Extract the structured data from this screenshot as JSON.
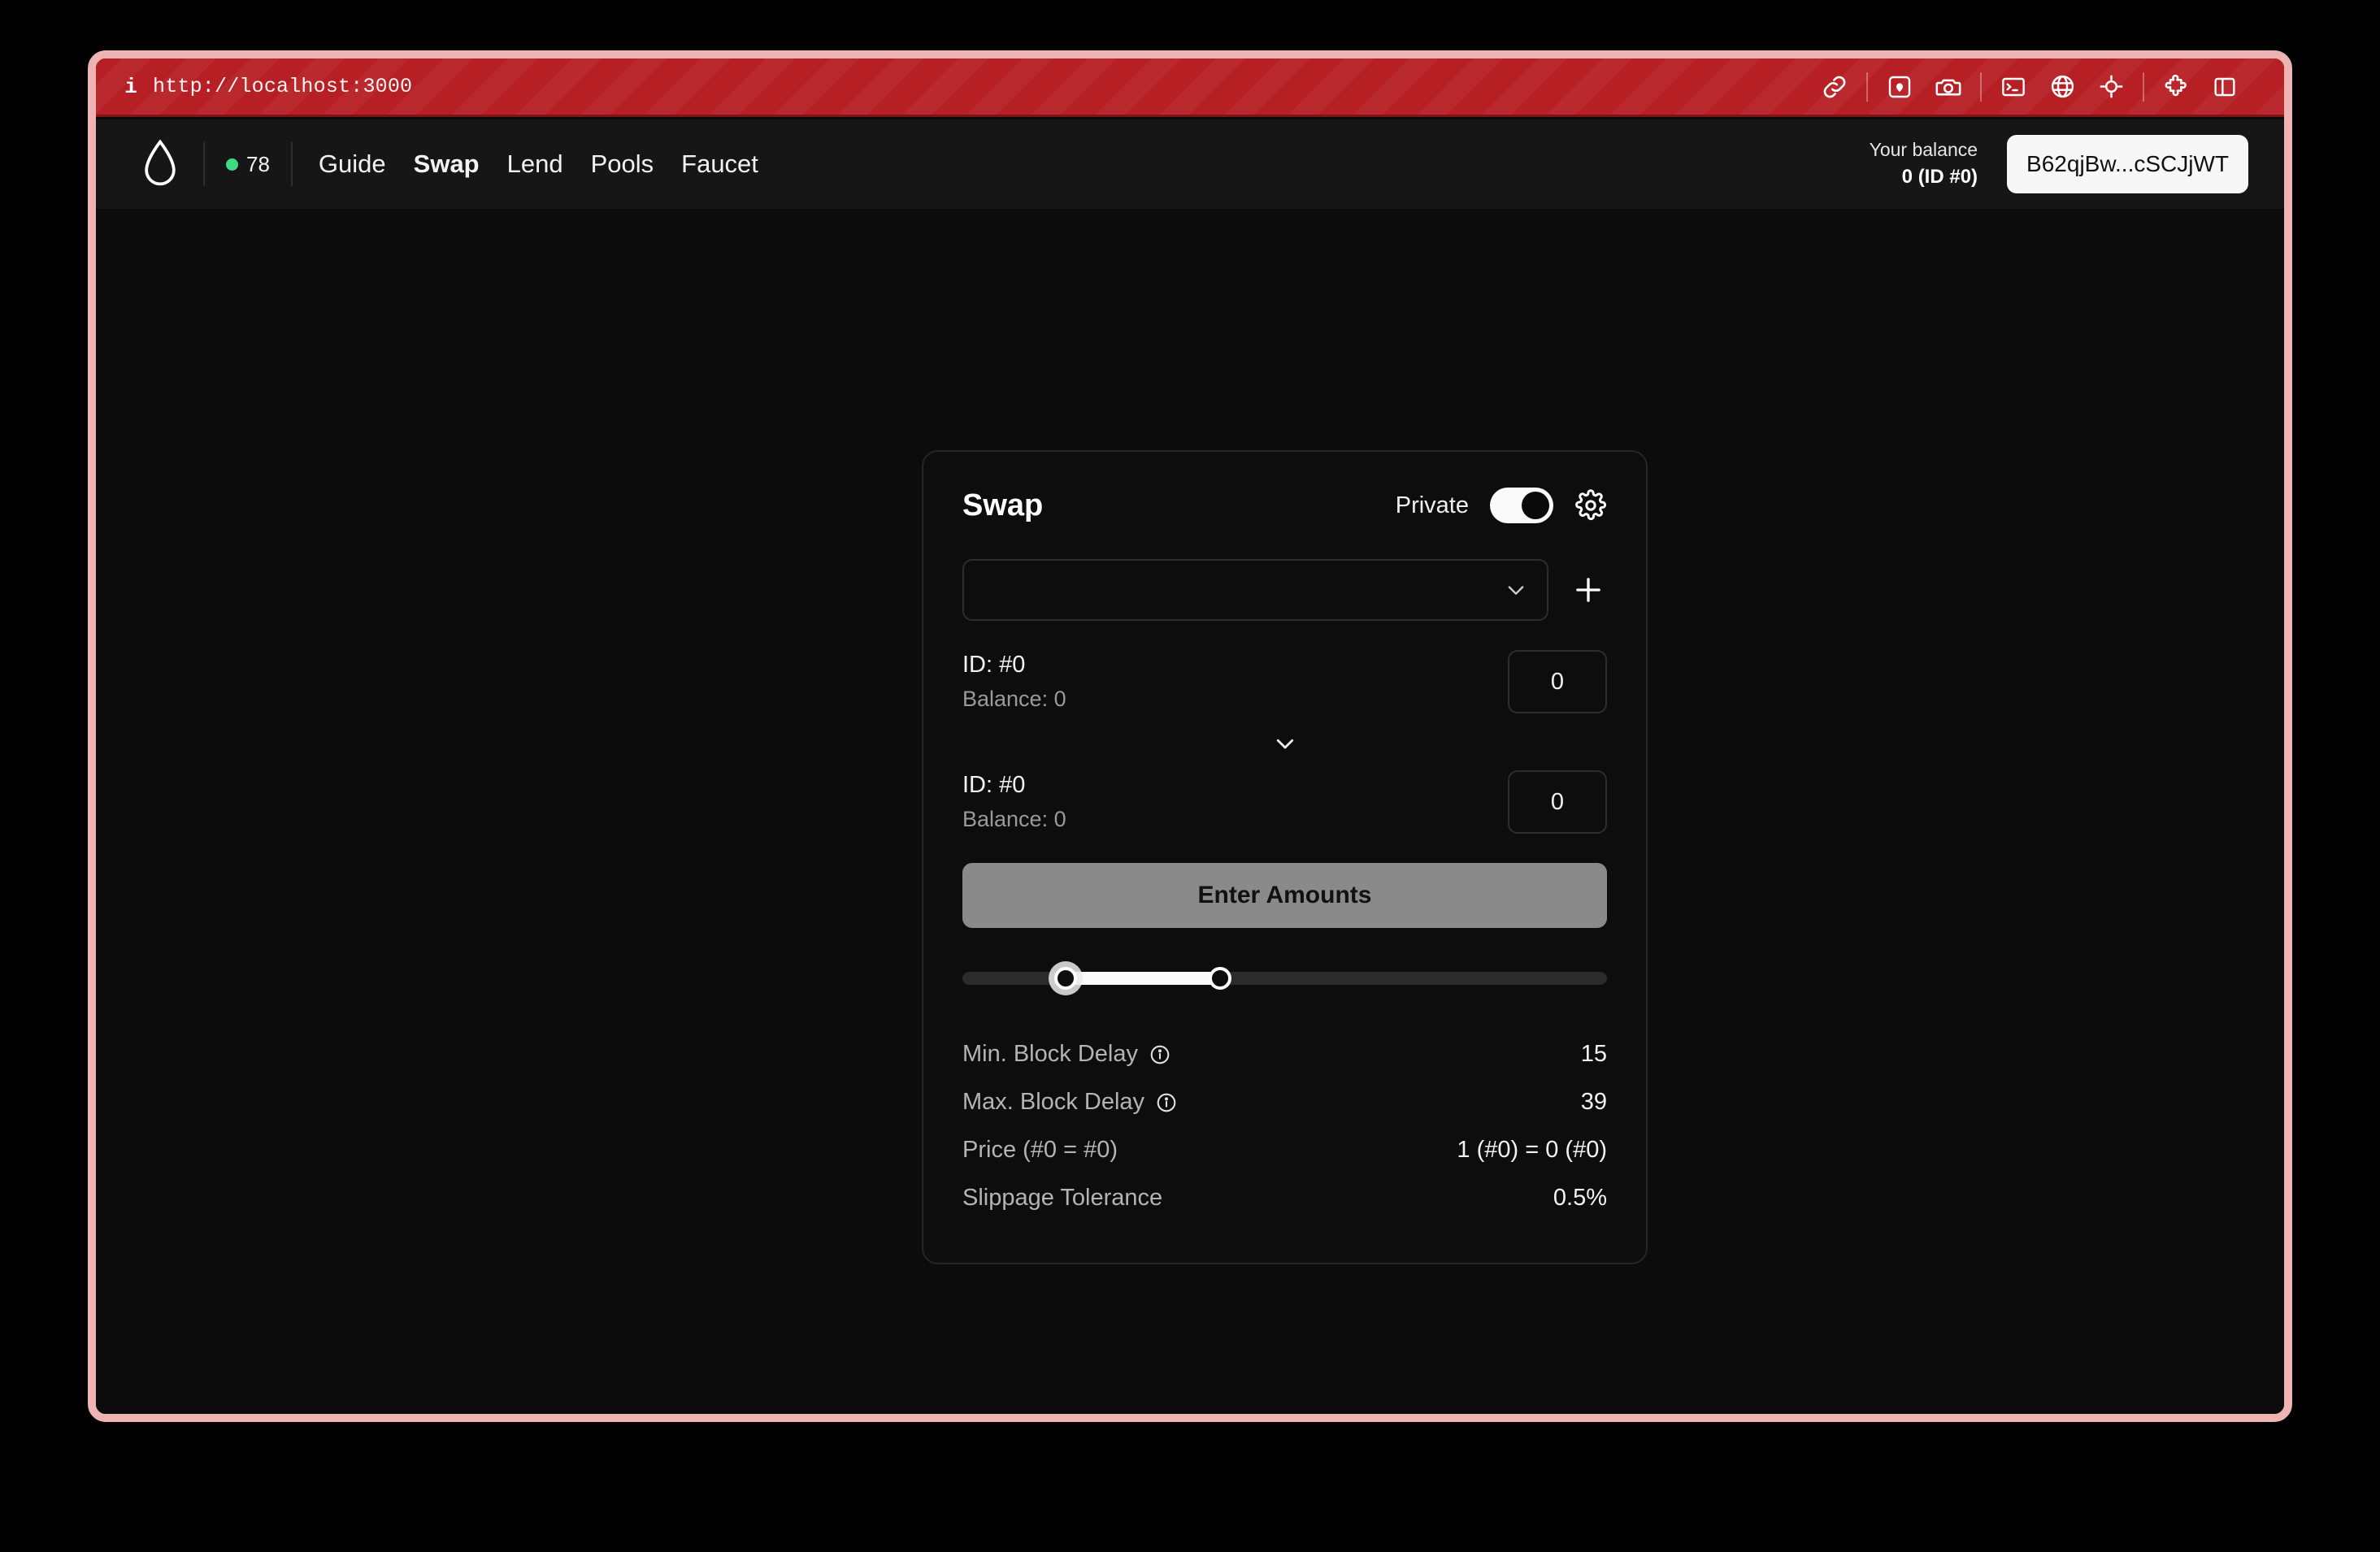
{
  "browser": {
    "info_glyph": "i",
    "url": "http://localhost:3000",
    "tools": [
      {
        "name": "link-icon",
        "label": "link"
      },
      {
        "name": "image-icon",
        "label": "image"
      },
      {
        "name": "camera-icon",
        "label": "camera"
      },
      {
        "name": "terminal-icon",
        "label": "terminal"
      },
      {
        "name": "globe-icon",
        "label": "globe"
      },
      {
        "name": "crosshair-icon",
        "label": "crosshair"
      },
      {
        "name": "puzzle-icon",
        "label": "extensions"
      },
      {
        "name": "split-panel-icon",
        "label": "split panel"
      }
    ]
  },
  "nav": {
    "logo": "droplet-icon",
    "status_count": "78",
    "status_color": "#3ddc84",
    "links": [
      {
        "label": "Guide",
        "active": false
      },
      {
        "label": "Swap",
        "active": true
      },
      {
        "label": "Lend",
        "active": false
      },
      {
        "label": "Pools",
        "active": false
      },
      {
        "label": "Faucet",
        "active": false
      }
    ],
    "balance_label": "Your balance",
    "balance_value": "0 (ID #0)",
    "address": "B62qjBw...cSCJjWT"
  },
  "swap": {
    "title": "Swap",
    "private_label": "Private",
    "private_on": true,
    "settings_icon": "gear-icon",
    "token_select": {
      "value": "",
      "placeholder": ""
    },
    "add_token_icon": "plus-icon",
    "from": {
      "id": "ID: #0",
      "balance": "Balance: 0",
      "amount": "0"
    },
    "to": {
      "id": "ID: #0",
      "balance": "Balance: 0",
      "amount": "0"
    },
    "action_button": "Enter Amounts",
    "slider": {
      "min_percent": 16,
      "max_percent": 40
    },
    "info_rows": [
      {
        "label": "Min. Block Delay",
        "has_info_icon": true,
        "value": "15"
      },
      {
        "label": "Max. Block Delay",
        "has_info_icon": true,
        "value": "39"
      },
      {
        "label": "Price (#0 = #0)",
        "has_info_icon": false,
        "value": "1 (#0) = 0 (#0)"
      },
      {
        "label": "Slippage Tolerance",
        "has_info_icon": false,
        "value": "0.5%"
      }
    ]
  }
}
